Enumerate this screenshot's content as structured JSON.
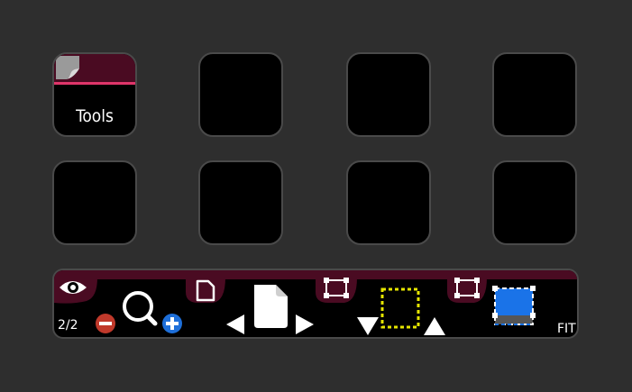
{
  "keys": {
    "tools_label": "Tools"
  },
  "toolbar": {
    "page_indicator": "2/2",
    "fit_label": "FIT"
  },
  "colors": {
    "background": "#2e2e2e",
    "key_border": "#4a4a4a",
    "accent_band": "#4a0b22",
    "accent_line": "#e0356a",
    "zoom_out": "#c0392b",
    "zoom_in": "#1e6fd9",
    "selection": "#e6e600",
    "fit_blue": "#1a73e8"
  },
  "icons": [
    "page-curl-icon",
    "eye-icon",
    "zoom-out-icon",
    "magnifier-icon",
    "zoom-in-icon",
    "document-icon",
    "page-icon",
    "previous-arrow-icon",
    "next-arrow-icon",
    "frame-icon",
    "down-arrow-icon",
    "selection-box-icon",
    "up-arrow-icon",
    "fit-page-icon"
  ]
}
